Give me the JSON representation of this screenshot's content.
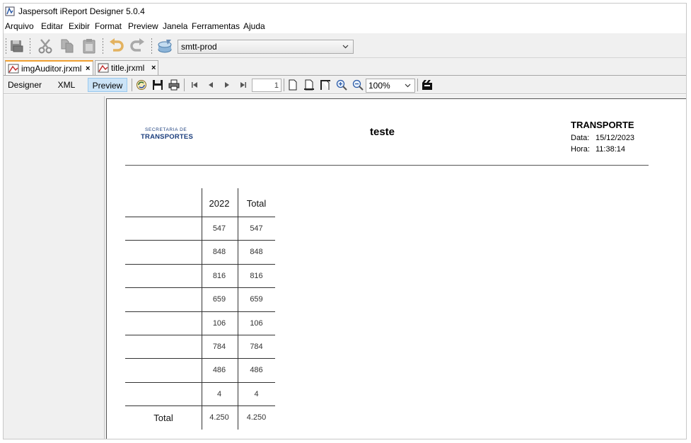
{
  "window": {
    "title": "Jaspersoft iReport Designer 5.0.4"
  },
  "menu": [
    "Arquivo",
    "Editar",
    "Exibir",
    "Format",
    "Preview",
    "Janela",
    "Ferramentas",
    "Ajuda"
  ],
  "toolbar": {
    "connection_value": "smtt-prod",
    "icons": [
      "save-icon",
      "cut-icon",
      "copy-icon",
      "paste-icon",
      "undo-icon",
      "redo-icon",
      "datasource-icon"
    ]
  },
  "tabs": [
    {
      "label": "imgAuditor.jrxml",
      "close": "×",
      "active": true
    },
    {
      "label": "title.jrxml",
      "close": "×",
      "active": false
    }
  ],
  "view": {
    "designer_label": "Designer",
    "xml_label": "XML",
    "preview_label": "Preview",
    "page_number": "1",
    "zoom_value": "100%"
  },
  "report": {
    "logo_line1": "SECRETARIA DE",
    "logo_line2": "TRANSPORTES",
    "title": "teste",
    "org": "TRANSPORTE",
    "date_label": "Data:",
    "date_value": "15/12/2023",
    "time_label": "Hora:",
    "time_value": "11:38:14",
    "crosstab": {
      "columns": [
        "2022",
        "Total"
      ],
      "rows": [
        {
          "label": "",
          "values": [
            "547",
            "547"
          ]
        },
        {
          "label": "",
          "values": [
            "848",
            "848"
          ]
        },
        {
          "label": "",
          "values": [
            "816",
            "816"
          ]
        },
        {
          "label": "",
          "values": [
            "659",
            "659"
          ]
        },
        {
          "label": "",
          "values": [
            "106",
            "106"
          ]
        },
        {
          "label": "",
          "values": [
            "784",
            "784"
          ]
        },
        {
          "label": "",
          "values": [
            "486",
            "486"
          ]
        },
        {
          "label": "",
          "values": [
            "4",
            "4"
          ]
        }
      ],
      "total_label": "Total",
      "total_values": [
        "4.250",
        "4.250"
      ]
    }
  }
}
